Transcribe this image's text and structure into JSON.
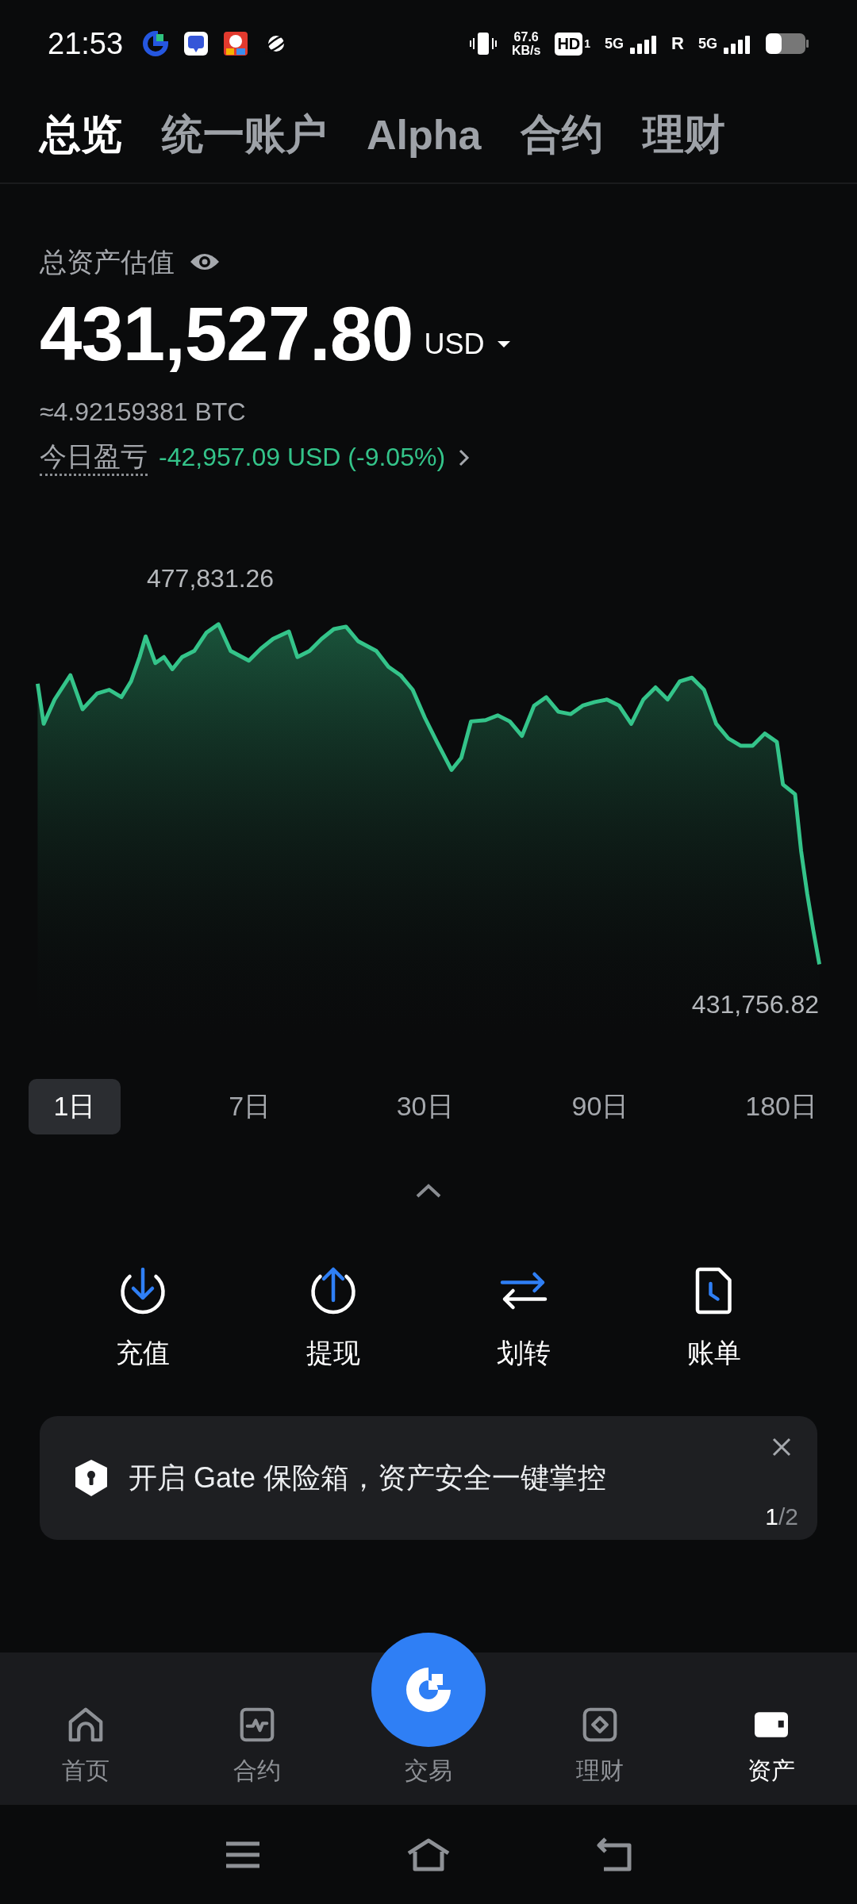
{
  "status_bar": {
    "time": "21:53",
    "net_speed": "67.6",
    "net_unit": "KB/s",
    "hd": "HD",
    "hd_sub": "1",
    "sim1": "5G",
    "roaming": "R",
    "sim2": "5G"
  },
  "tabs": [
    {
      "label": "总览",
      "selected": true
    },
    {
      "label": "统一账户",
      "selected": false
    },
    {
      "label": "Alpha",
      "selected": false
    },
    {
      "label": "合约",
      "selected": false
    },
    {
      "label": "理财",
      "selected": false
    }
  ],
  "summary": {
    "label": "总资产估值",
    "total": "431,527.80",
    "currency": "USD",
    "btc": "≈4.92159381 BTC",
    "pnl_label": "今日盈亏",
    "pnl_value": "-42,957.09 USD (-9.05%)"
  },
  "chart": {
    "high": "477,831.26",
    "low": "431,756.82"
  },
  "periods": [
    {
      "label": "1日",
      "selected": true
    },
    {
      "label": "7日",
      "selected": false
    },
    {
      "label": "30日",
      "selected": false
    },
    {
      "label": "90日",
      "selected": false
    },
    {
      "label": "180日",
      "selected": false
    }
  ],
  "actions": [
    {
      "label": "充值",
      "kind": "deposit"
    },
    {
      "label": "提现",
      "kind": "withdraw"
    },
    {
      "label": "划转",
      "kind": "transfer"
    },
    {
      "label": "账单",
      "kind": "bill"
    }
  ],
  "banner": {
    "text": "开启 Gate 保险箱，资产安全一键掌控",
    "page": "1",
    "total": "/2"
  },
  "bottom_nav": [
    {
      "label": "首页",
      "kind": "home",
      "selected": false
    },
    {
      "label": "合约",
      "kind": "futures",
      "selected": false
    },
    {
      "label": "交易",
      "kind": "trade",
      "selected": false
    },
    {
      "label": "理财",
      "kind": "earn",
      "selected": false
    },
    {
      "label": "资产",
      "kind": "assets",
      "selected": true
    }
  ]
}
